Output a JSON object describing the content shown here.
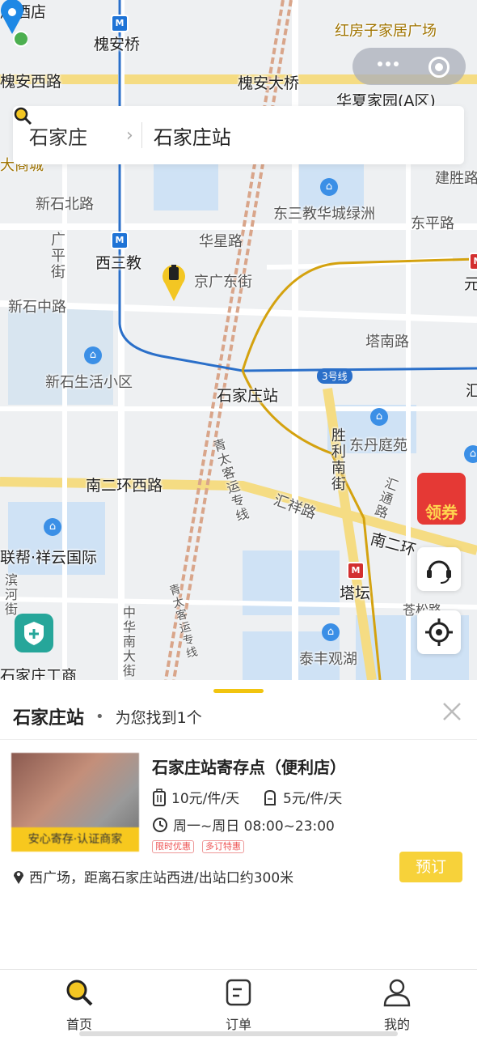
{
  "map": {
    "labels": {
      "top_hotel": "居酒店",
      "huaian_bridge": "槐安桥",
      "hongfang": "红房子家居广场",
      "huaian_west": "槐安西路",
      "huaian_ave": "槐安大桥",
      "huaxia": "华夏家园(A区)",
      "dalecheng": "大商城",
      "jianshenglu": "建胜路",
      "xinshi_north": "新石北路",
      "dongsanjiao": "东三教华城绿洲",
      "dongpinglu": "东平路",
      "guangpingjie": "广平街",
      "huaxinglu": "华星路",
      "xisanjiao": "西三教",
      "jingguang": "京广东街",
      "yuan": "元",
      "xinshi_middle": "新石中路",
      "tananlu": "塔南路",
      "xinshi_living": "新石生活小区",
      "line3": "3号线",
      "station": "石家庄站",
      "hui": "汇",
      "qingtai_1": "青太客运专线",
      "shengli_south": "胜利南街",
      "dongdan": "东丹庭苑",
      "nanerhuan_west": "南二环西路",
      "huixiang": "汇祥路",
      "huitong": "汇通路",
      "nanerhuan": "南二环",
      "lianbang": "联帮·祥云国际",
      "binhe": "滨河街",
      "tatan": "塔坛",
      "zhonghua": "中华南大街",
      "qingtai_2": "青太客运专线",
      "canglu": "苍松路",
      "taifeng": "泰丰观湖",
      "gongshang": "石家庄工商"
    }
  },
  "search": {
    "city": "石家庄",
    "query": "石家庄站"
  },
  "coupon": {
    "label": "领券"
  },
  "sheet": {
    "title": "石家庄站",
    "result_text": "为您找到1个"
  },
  "store": {
    "name": "石家庄站寄存点（便利店）",
    "badge": "安心寄存·认证商家",
    "price_large": "10元/件/天",
    "price_small": "5元/件/天",
    "hours": "周一~周日 08:00~23:00",
    "tags": [
      "限时优惠",
      "多订特惠"
    ],
    "address": "西广场，距离石家庄站西进/出站口约300米",
    "book_label": "预订"
  },
  "tabs": [
    {
      "label": "首页",
      "icon": "search-icon"
    },
    {
      "label": "订单",
      "icon": "order-icon"
    },
    {
      "label": "我的",
      "icon": "user-icon"
    }
  ]
}
